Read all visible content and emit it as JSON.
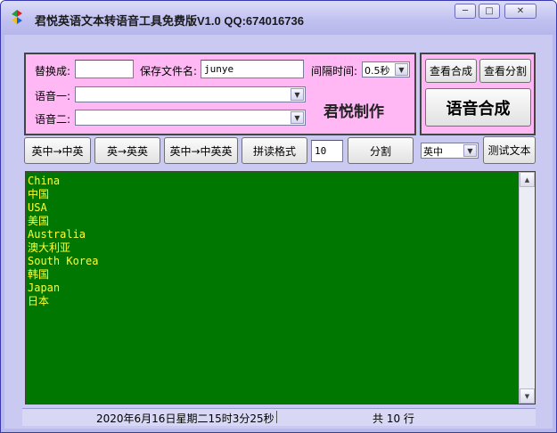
{
  "window": {
    "title": "君悦英语文本转语音工具免费版V1.0   QQ:674016736",
    "controls": {
      "minimize": "─",
      "maximize": "□",
      "close": "✕"
    }
  },
  "form": {
    "replace_label": "替换成:",
    "replace_value": "",
    "filename_label": "保存文件名:",
    "filename_value": "junye",
    "interval_label": "间隔时间:",
    "interval_value": "0.5秒",
    "voice1_label": "语音一:",
    "voice1_value": "",
    "voice2_label": "语音二:",
    "voice2_value": "",
    "brand_text": "君悦制作"
  },
  "right_panel": {
    "view_synth_label": "查看合成",
    "view_split_label": "查看分割",
    "synthesize_label": "语音合成"
  },
  "toolbar": {
    "en_cn_en_label": "英中→中英",
    "en_enen_label": "英→英英",
    "en_cn_cnenen_label": "英中→中英英",
    "phonetic_format_label": "拼读格式",
    "split_count_value": "10",
    "split_label": "分割",
    "lang_select_value": "英中",
    "test_text_label": "测试文本"
  },
  "editor": {
    "lines": [
      "China",
      "中国",
      "USA",
      "美国",
      "Australia",
      "澳大利亚",
      "South Korea",
      "韩国",
      "Japan",
      "日本"
    ]
  },
  "status": {
    "datetime": "2020年6月16日星期二15时3分25秒",
    "line_count": "共 10 行"
  },
  "colors": {
    "panel_pink": "#ffb8f4",
    "editor_bg": "#007700",
    "editor_text": "#ffff33",
    "window_bg": "#c9c9f2"
  }
}
